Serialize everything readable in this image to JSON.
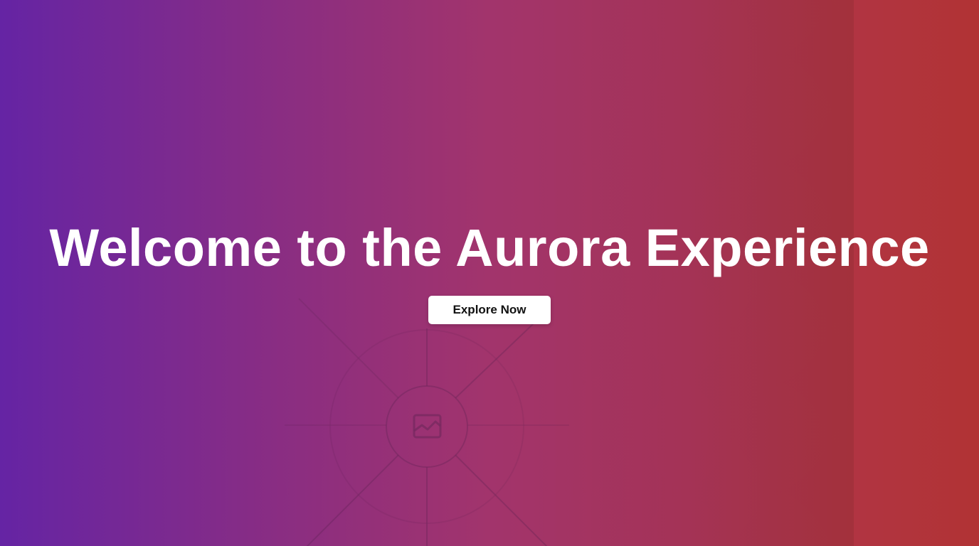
{
  "hero": {
    "headline": "Welcome to the Aurora Experience",
    "cta_label": "Explore Now"
  },
  "colors": {
    "gradient_start": "#6524a4",
    "gradient_mid": "#a2346c",
    "gradient_end": "#b13334",
    "headline_text": "#ffffff",
    "button_background": "#ffffff",
    "button_text": "#111111"
  },
  "icons": {
    "background_placeholder": "image-placeholder-icon"
  }
}
